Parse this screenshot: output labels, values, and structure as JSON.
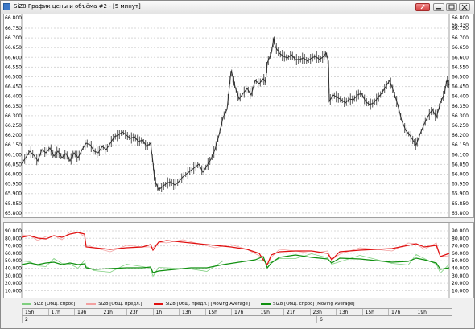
{
  "window": {
    "title": "SiZ8 График цены и объёма #2 - [5 минут]"
  },
  "price_axis": {
    "labels": [
      "66.750",
      "66.700",
      "66.650",
      "66.600",
      "66.550",
      "66.500",
      "66.450",
      "66.400",
      "66.350",
      "66.300",
      "66.250",
      "66.200",
      "66.150",
      "66.100",
      "66.050",
      "66.000",
      "65.950",
      "65.900",
      "65.850",
      "65.800"
    ],
    "left_top_label": "66.800",
    "right_top_label": "66.800",
    "right_mid_label": "66.330"
  },
  "volume_axis": {
    "labels": [
      "90.000",
      "80.000",
      "70.000",
      "60.000",
      "50.000",
      "40.000",
      "30.000",
      "20.000",
      "10.000"
    ]
  },
  "legend": [
    {
      "label": "SiZ8 [Общ. спрос]",
      "color": "#7fcf7f"
    },
    {
      "label": "SiZ8 [Общ. предл.]",
      "color": "#f2a0a0"
    },
    {
      "label": "SiZ8 [Общ. предл.] [Moving Average]",
      "color": "#e01010"
    },
    {
      "label": "SiZ8 [Общ. спрос] [Moving Average]",
      "color": "#109010"
    }
  ],
  "time_labels": [
    "15h",
    "17h",
    "19h",
    "21h",
    "23h",
    "1h",
    "13h",
    "15h",
    "17h",
    "19h",
    "21h",
    "23h",
    "13h",
    "15h",
    "17h",
    "19h"
  ],
  "date_labels": [
    "2",
    "6"
  ],
  "colors": {
    "candle": "#303030",
    "grid": "#d8d8d8",
    "ask": "#e01010",
    "bid": "#109010",
    "ask_raw": "#f2a0a0",
    "bid_raw": "#7fcf7f"
  }
}
